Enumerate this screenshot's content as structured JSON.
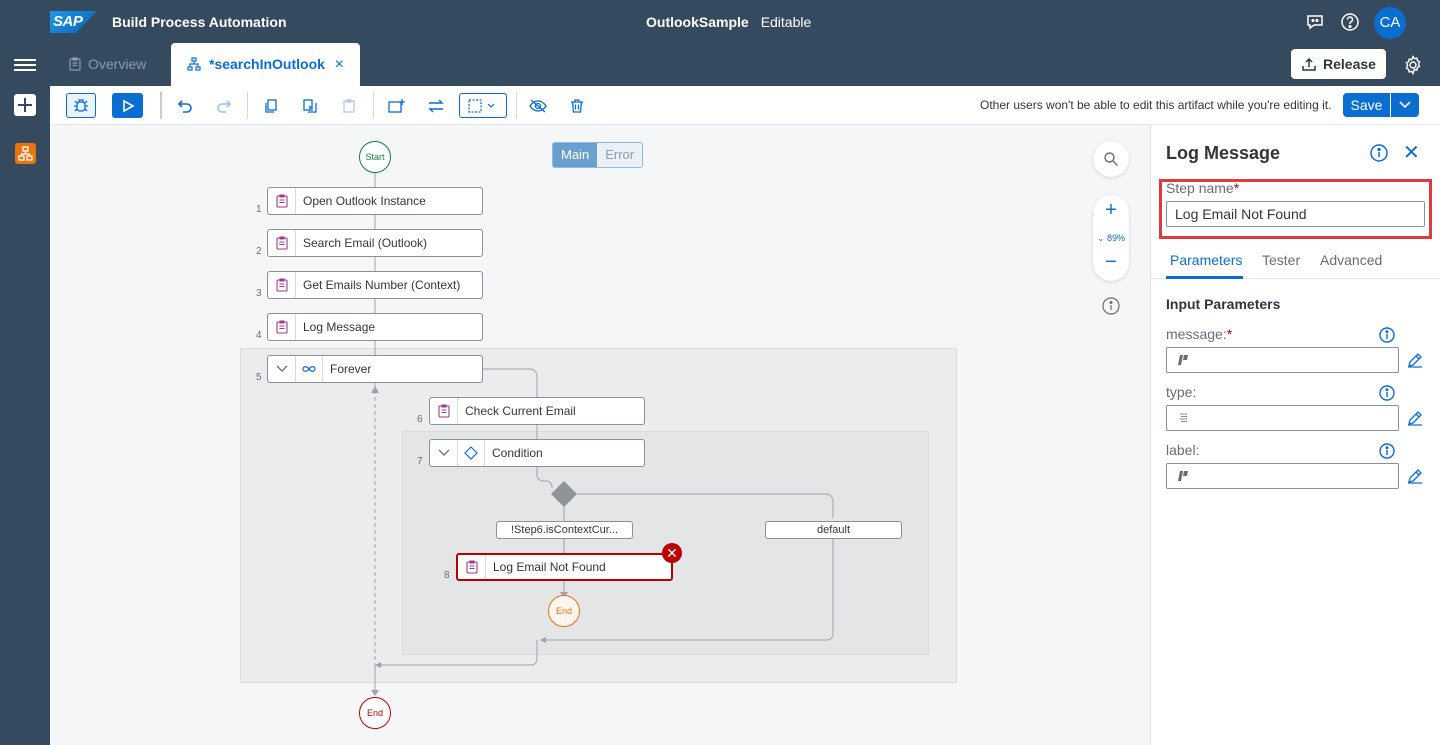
{
  "shell": {
    "logo": "SAP",
    "app_title": "Build Process Automation",
    "project_name": "OutlookSample",
    "project_state": "Editable",
    "avatar_initials": "CA"
  },
  "tabs": [
    {
      "label": "Overview",
      "active": false
    },
    {
      "label": "*searchInOutlook",
      "active": true,
      "close": "×"
    }
  ],
  "header": {
    "release_label": "Release"
  },
  "toolbar": {
    "lock_note": "Other users won't be able to edit this artifact while you're editing it.",
    "save_label": "Save"
  },
  "canvas": {
    "segments": [
      "Main",
      "Error"
    ],
    "start_label": "Start",
    "end_label": "End",
    "zoom_plus": "+",
    "zoom_minus": "−",
    "zoom_level": "⌄ 89%",
    "steps": [
      {
        "num": "1",
        "label": "Open Outlook Instance"
      },
      {
        "num": "2",
        "label": "Search Email (Outlook)"
      },
      {
        "num": "3",
        "label": "Get Emails Number (Context)"
      },
      {
        "num": "4",
        "label": "Log Message"
      },
      {
        "num": "5",
        "label": "Forever"
      },
      {
        "num": "6",
        "label": "Check Current Email"
      },
      {
        "num": "7",
        "label": "Condition"
      },
      {
        "num": "8",
        "label": "Log Email Not Found"
      }
    ],
    "branch_condition": "!Step6.isContextCur...",
    "branch_default": "default",
    "error_badge": "✕",
    "inner_end_label": "End"
  },
  "panel": {
    "title": "Log Message",
    "close": "✕",
    "step_name_label": "Step name",
    "required_mark": "*",
    "step_name_value": "Log Email Not Found",
    "tabs": [
      "Parameters",
      "Tester",
      "Advanced"
    ],
    "section_title": "Input Parameters",
    "params": [
      {
        "label": "message:",
        "required": true
      },
      {
        "label": "type:",
        "required": false
      },
      {
        "label": "label:",
        "required": false
      }
    ]
  },
  "colors": {
    "shell": "#354a5f",
    "accent": "#0a6ed1",
    "error": "#bb0000",
    "highlight": "#e0393e"
  }
}
